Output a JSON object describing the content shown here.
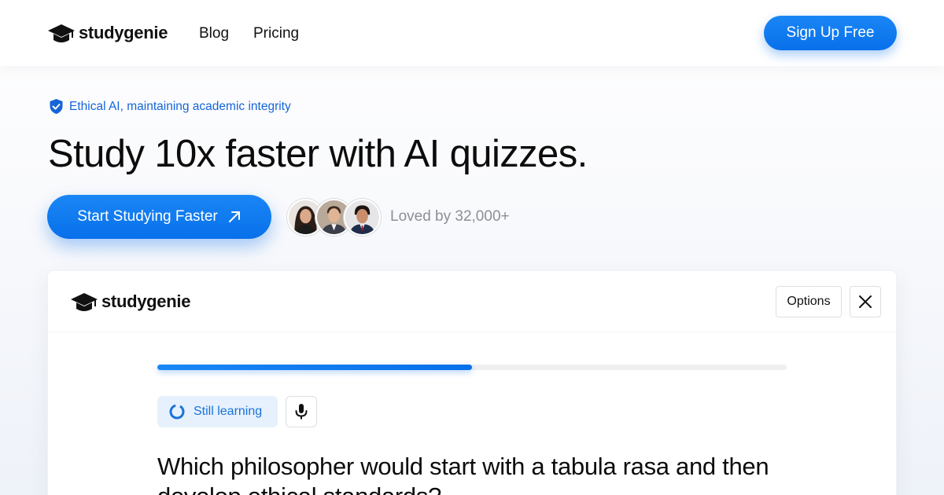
{
  "nav": {
    "brand": "studygenie",
    "brand_icon": "graduation-cap-icon",
    "links": [
      "Blog",
      "Pricing"
    ],
    "signup_label": "Sign Up Free"
  },
  "hero": {
    "badge_icon": "shield-check-icon",
    "badge_text": "Ethical AI, maintaining academic integrity",
    "headline": "Study 10x faster with AI quizzes.",
    "cta_label": "Start Studying Faster",
    "cta_icon": "arrow-up-right-icon",
    "social_proof": "Loved by 32,000+"
  },
  "quiz_card": {
    "brand": "studygenie",
    "options_label": "Options",
    "close_icon": "close-icon",
    "progress": 0.5,
    "status_label": "Still learning",
    "status_icon": "loading-ring-icon",
    "mic_icon": "microphone-icon",
    "question": "Which philosopher would start with a tabula rasa and then develop ethical standards?"
  },
  "colors": {
    "accent": "#0870ea",
    "badge_text": "#1565d8",
    "status_bg": "#e6f1fd",
    "muted_text": "#8b8f97"
  }
}
